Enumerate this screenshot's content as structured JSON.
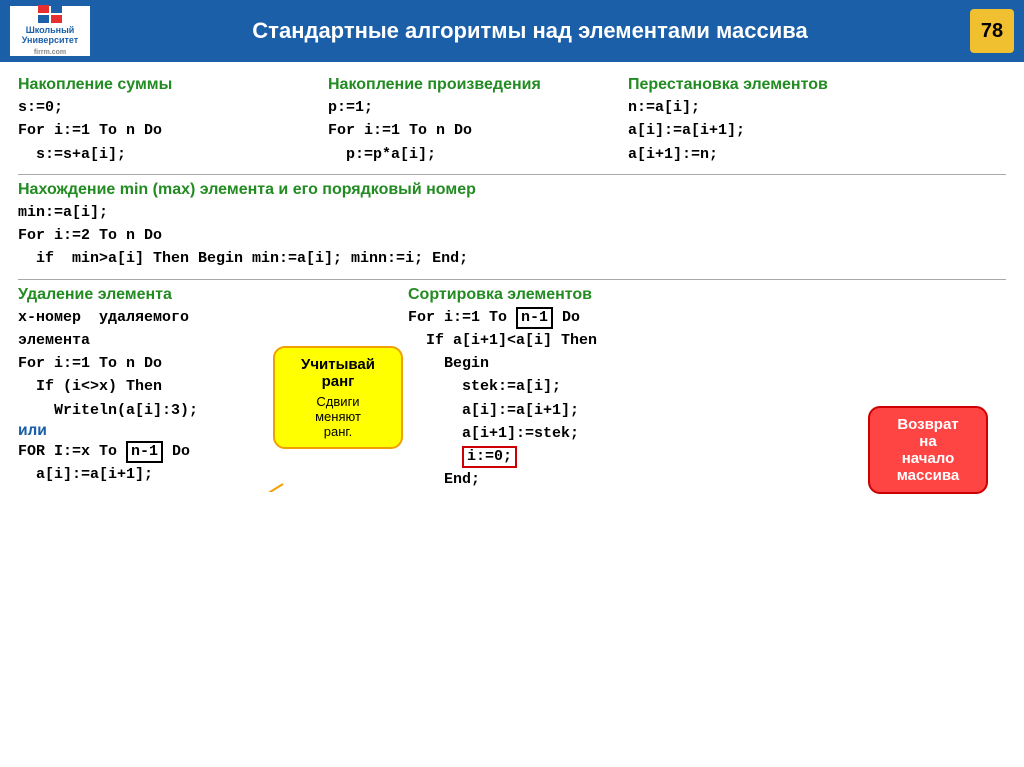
{
  "header": {
    "title": "Стандартные алгоритмы над элементами массива",
    "page_number": "78",
    "logo_line1": "Школьный",
    "logo_line2": "Университет",
    "logo_line3": "firrm.com"
  },
  "sections": {
    "sum": {
      "title": "Накопление суммы",
      "code": "s:=0;\nFor i:=1 To n Do\n  s:=s+a[i];"
    },
    "product": {
      "title": "Накопление произведения",
      "code": "p:=1;\nFor i:=1 To n Do\n  p:=p*a[i];"
    },
    "swap": {
      "title": "Перестановка элементов",
      "code": "n:=a[i];\na[i]:=a[i+1];\na[i+1]:=n;"
    },
    "minmax": {
      "title": "Нахождение  min (max) элемента и его порядковый номер",
      "code1": "min:=a[i];",
      "code2": "For i:=2 To n Do",
      "code3": "  if  min>a[i] Then Begin min:=a[i]; minn:=i; End;"
    },
    "delete": {
      "title": "Удаление элемента",
      "code_lines": [
        "x-номер  удаляемого",
        "элемента",
        "For i:=1 To n Do",
        "  If (i<>x) Then",
        "    Writeln(a[i]:3);"
      ],
      "ili": "или",
      "code_lines2": [
        "FOR I:=x To n-1 Do",
        "  a[i]:=a[i+1];"
      ]
    },
    "sort": {
      "title": "Сортировка элементов",
      "code_lines": [
        "For i:=1 To n-1 Do",
        "  If a[i+1]<a[i] Then",
        "    Begin",
        "      stek:=a[i];",
        "      a[i]:=a[i+1];",
        "      a[i+1]:=stek;",
        "      i:=0;",
        "    End;"
      ]
    },
    "callout1": {
      "line1": "Учитывай",
      "line2": "ранг",
      "line3": "Сдвиги",
      "line4": "меняют",
      "line5": "ранг."
    },
    "callout2": {
      "line1": "Возврат",
      "line2": "на",
      "line3": "начало",
      "line4": "массива"
    }
  }
}
